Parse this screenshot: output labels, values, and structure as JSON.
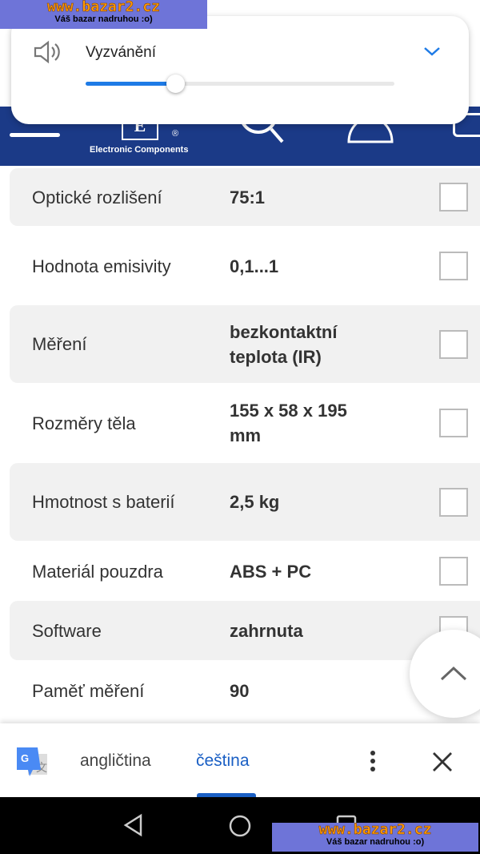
{
  "watermark": {
    "site": "www.bazar2.cz",
    "tagline": "Váš bazar nadruhou   :o)"
  },
  "volume_panel": {
    "label": "Vyzvánění",
    "level_percent": 29,
    "accent": "#1e7be6"
  },
  "header": {
    "logo_letter": "E",
    "logo_mark": "®",
    "logo_text": "Electronic Components",
    "bg": "#1b3a87"
  },
  "specs": [
    {
      "label": "Optické rozlišení",
      "value": "75:1"
    },
    {
      "label": "Hodnota emisivity",
      "value": "0,1...1"
    },
    {
      "label": "Měření",
      "value": "bezkontaktní teplota (IR)"
    },
    {
      "label": "Rozměry těla",
      "value": "155 x 58 x 195 mm"
    },
    {
      "label": "Hmotnost s baterií",
      "value": "2,5 kg"
    },
    {
      "label": "Materiál pouzdra",
      "value": "ABS + PC"
    },
    {
      "label": "Software",
      "value": "zahrnuta"
    },
    {
      "label": "Paměť měření",
      "value": "90"
    }
  ],
  "translate_bar": {
    "source_lang": "angličtina",
    "target_lang": "čeština",
    "active": "čeština",
    "accent": "#1a5fc4"
  }
}
